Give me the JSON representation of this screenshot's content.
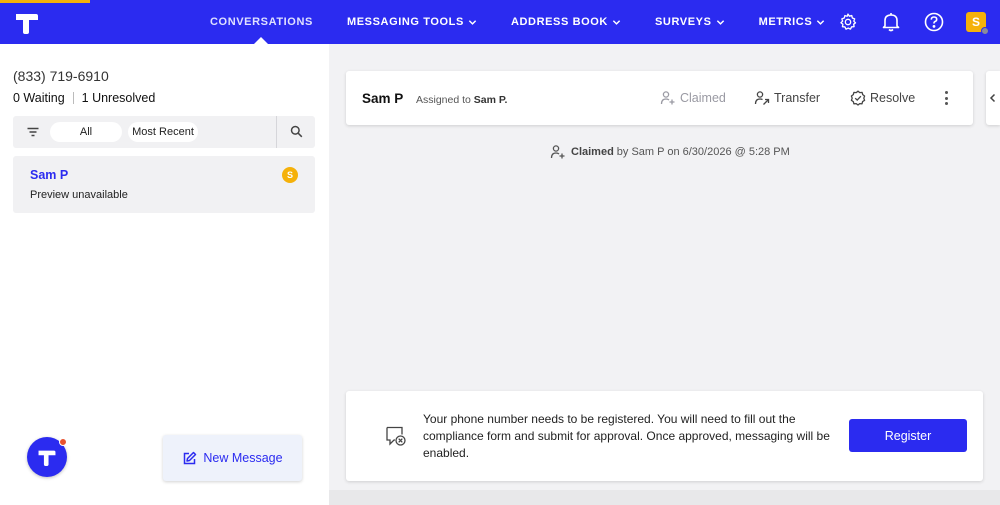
{
  "colors": {
    "brand": "#2b2bf0",
    "accent": "#f5b10a",
    "notify": "#e8522f"
  },
  "nav": {
    "items": [
      {
        "label": "CONVERSATIONS",
        "active": true,
        "dropdown": false
      },
      {
        "label": "MESSAGING TOOLS",
        "active": false,
        "dropdown": true
      },
      {
        "label": "ADDRESS BOOK",
        "active": false,
        "dropdown": true
      },
      {
        "label": "SURVEYS",
        "active": false,
        "dropdown": true
      },
      {
        "label": "METRICS",
        "active": false,
        "dropdown": true
      }
    ],
    "icons": [
      "gear-icon",
      "bell-icon",
      "help-icon"
    ],
    "avatar_initial": "S"
  },
  "inbox": {
    "phone": "(833) 719-6910",
    "waiting": "0 Waiting",
    "unresolved": "1 Unresolved",
    "filter_all": "All",
    "filter_recent": "Most Recent"
  },
  "conversations": [
    {
      "name": "Sam P",
      "preview": "Preview unavailable",
      "badge": "S"
    }
  ],
  "new_message_label": "New Message",
  "thread": {
    "contact_name": "Sam P",
    "assigned_prefix": "Assigned to",
    "assigned_to": "Sam P.",
    "actions": {
      "claimed": "Claimed",
      "transfer": "Transfer",
      "resolve": "Resolve"
    },
    "claim_note": {
      "status": "Claimed",
      "detail": "by Sam P on 6/30/2026 @ 5:28 PM"
    }
  },
  "registration": {
    "message": "Your phone number needs to be registered. You will need to fill out the compliance form and submit for approval. Once approved, messaging will be enabled.",
    "button": "Register"
  }
}
